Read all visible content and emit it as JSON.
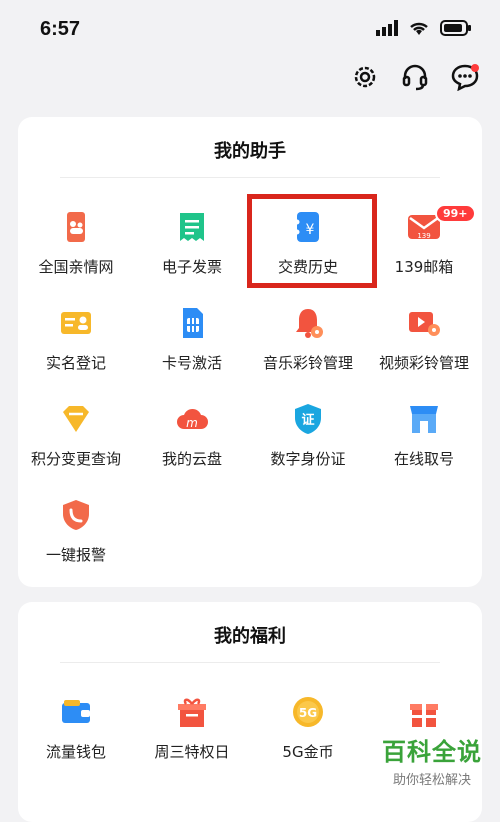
{
  "status": {
    "time": "6:57"
  },
  "top_actions": {
    "icons": [
      "settings-icon",
      "customer-service-icon",
      "message-icon"
    ]
  },
  "my_assistant": {
    "title": "我的助手",
    "items": [
      {
        "label": "全国亲情网",
        "icon": "family-network-icon"
      },
      {
        "label": "电子发票",
        "icon": "e-invoice-icon"
      },
      {
        "label": "交费历史",
        "icon": "payment-history-icon"
      },
      {
        "label": "139邮箱",
        "icon": "mail-139-icon",
        "badge": "99+"
      },
      {
        "label": "实名登记",
        "icon": "real-name-icon"
      },
      {
        "label": "卡号激活",
        "icon": "sim-card-icon"
      },
      {
        "label": "音乐彩铃管理",
        "icon": "music-ringtone-icon"
      },
      {
        "label": "视频彩铃管理",
        "icon": "video-ringtone-icon"
      },
      {
        "label": "积分变更查询",
        "icon": "points-icon"
      },
      {
        "label": "我的云盘",
        "icon": "cloud-drive-icon"
      },
      {
        "label": "数字身份证",
        "icon": "digital-id-icon"
      },
      {
        "label": "在线取号",
        "icon": "queue-number-icon"
      },
      {
        "label": "一键报警",
        "icon": "alarm-icon"
      }
    ]
  },
  "my_benefits": {
    "title": "我的福利",
    "items": [
      {
        "label": "流量钱包",
        "icon": "data-wallet-icon"
      },
      {
        "label": "周三特权日",
        "icon": "gift-box-icon"
      },
      {
        "label": "5G金币",
        "icon": "5g-coin-icon",
        "coin_text": "5G"
      },
      {
        "label": "",
        "icon": "gift-icon"
      }
    ]
  },
  "watermark": {
    "title": "百科全说",
    "subtitle": "助你轻松解决"
  },
  "colors": {
    "highlight": "#d9261c",
    "badge": "#ff3b3b",
    "watermark": "#3aa33a"
  }
}
